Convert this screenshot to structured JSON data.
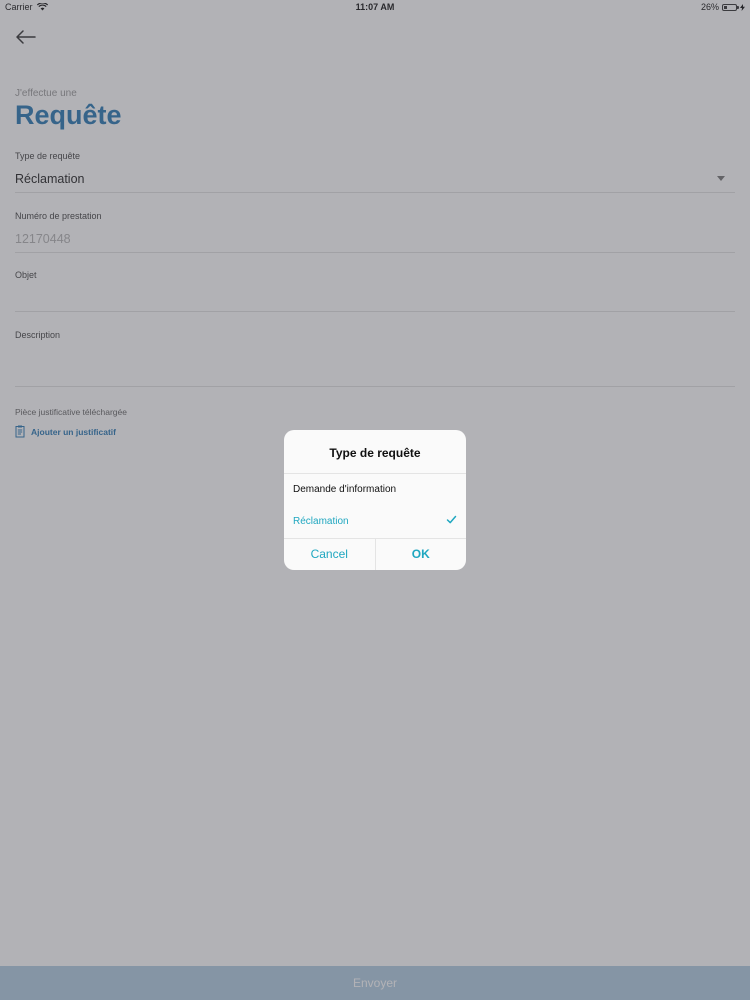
{
  "status_bar": {
    "carrier": "Carrier",
    "time": "11:07 AM",
    "battery": "26%",
    "battery_level": 0.26
  },
  "header": {
    "back_icon": "arrow-left-icon",
    "subtitle": "J'effectue une",
    "title": "Requête"
  },
  "form": {
    "request_type": {
      "label": "Type de requête",
      "value": "Réclamation"
    },
    "service_number": {
      "label": "Numéro de prestation",
      "value": "12170448"
    },
    "subject": {
      "label": "Objet",
      "value": ""
    },
    "description": {
      "label": "Description",
      "value": ""
    },
    "attachment": {
      "label": "Pièce justificative téléchargée",
      "link_label": "Ajouter un justificatif",
      "icon": "document-icon"
    }
  },
  "submit": {
    "label": "Envoyer"
  },
  "picker": {
    "title": "Type de requête",
    "options": [
      {
        "label": "Demande d'information",
        "selected": false
      },
      {
        "label": "Réclamation",
        "selected": true
      }
    ],
    "cancel_label": "Cancel",
    "ok_label": "OK"
  },
  "colors": {
    "accent_blue": "#2a79b4",
    "teal": "#1fa7c0",
    "bottom_bar": "#b2cde2"
  }
}
